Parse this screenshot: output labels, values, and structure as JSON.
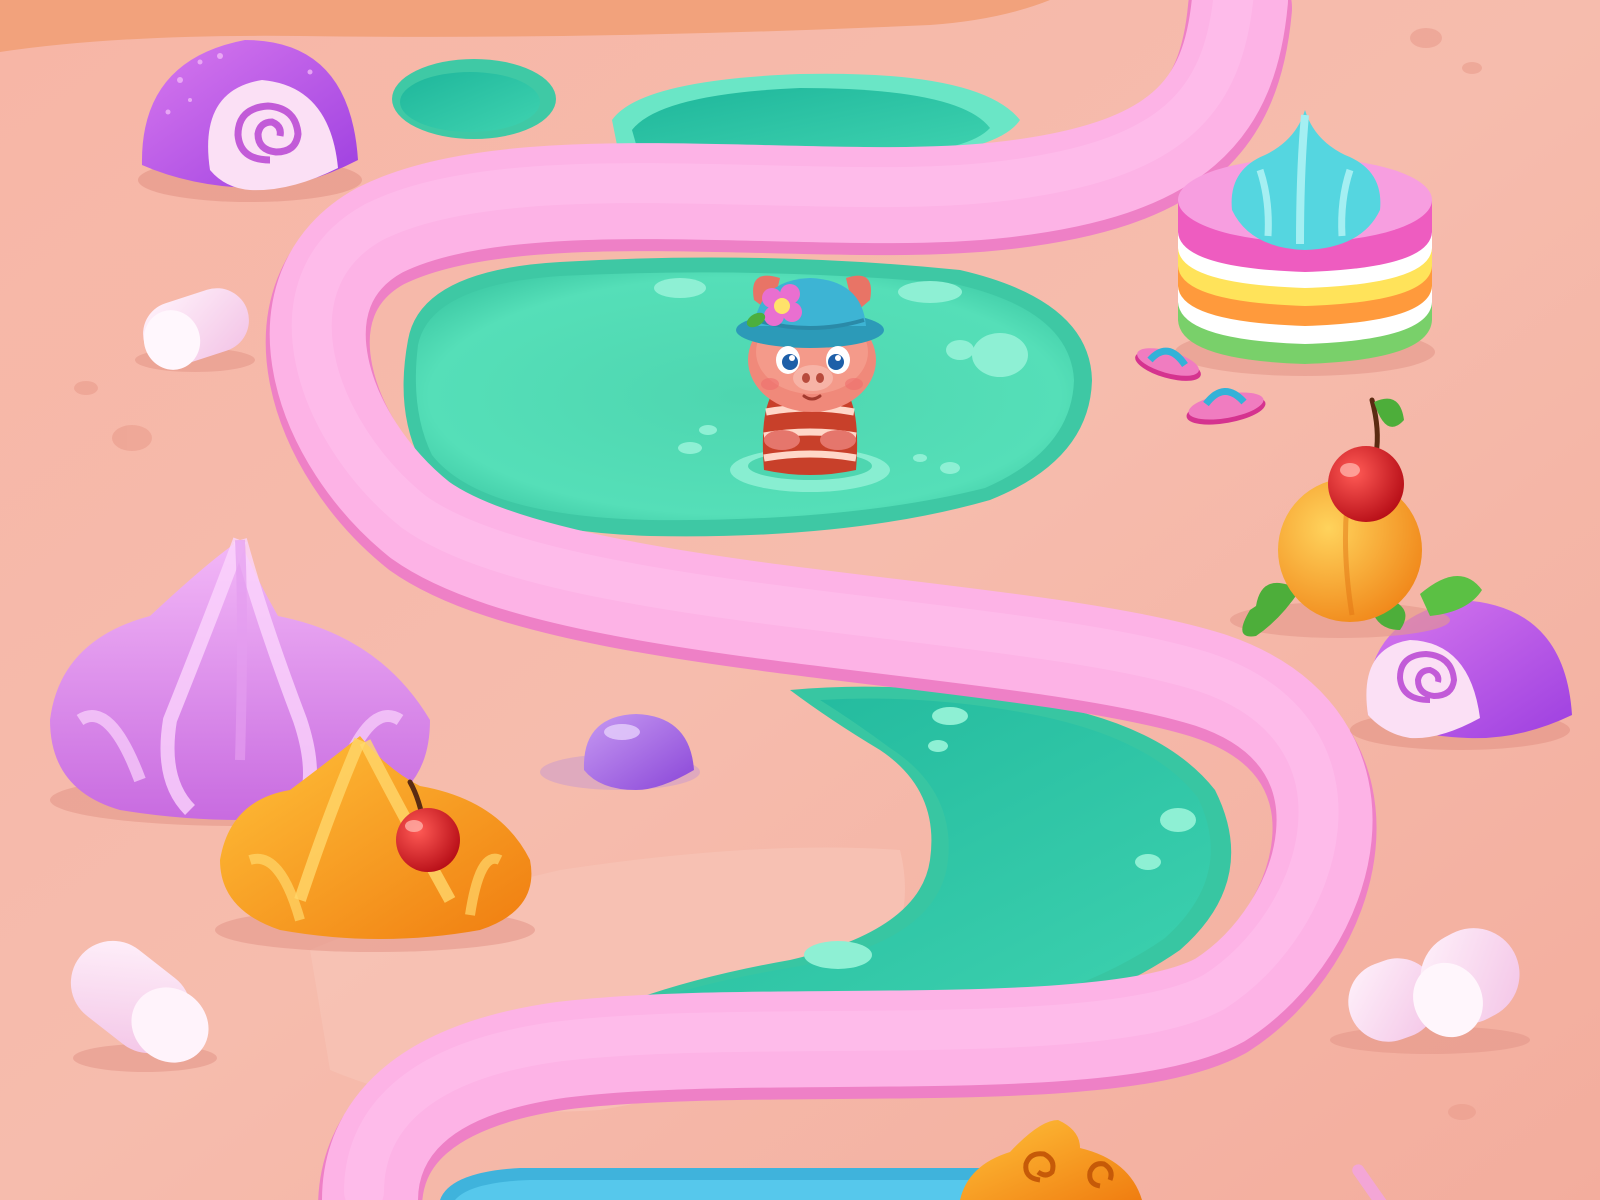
{
  "scene": {
    "type": "candy-land level map",
    "palette": {
      "ground": "#f4b3a3",
      "ground_light": "#f9c9bb",
      "path": "#fdb2e5",
      "path_shadow": "#ef84c8",
      "water": "#4fd8b0",
      "water_light": "#74ecc8",
      "water_deep": "#25c2a0",
      "blue_pool": "#5cc6e6"
    },
    "decorations": [
      "jelly-roll",
      "jelly-roll",
      "marshmallow",
      "marshmallow",
      "marshmallow",
      "meringue-lilac",
      "meringue-orange-with-cherry",
      "layer-cake",
      "flip-flops",
      "peach-with-cherry",
      "gumdrop",
      "orange-swirl-candy",
      "candy-stick"
    ],
    "character": {
      "kind": "pig in sun hat with flower",
      "icon": "pig-icon",
      "in": "pond"
    }
  }
}
